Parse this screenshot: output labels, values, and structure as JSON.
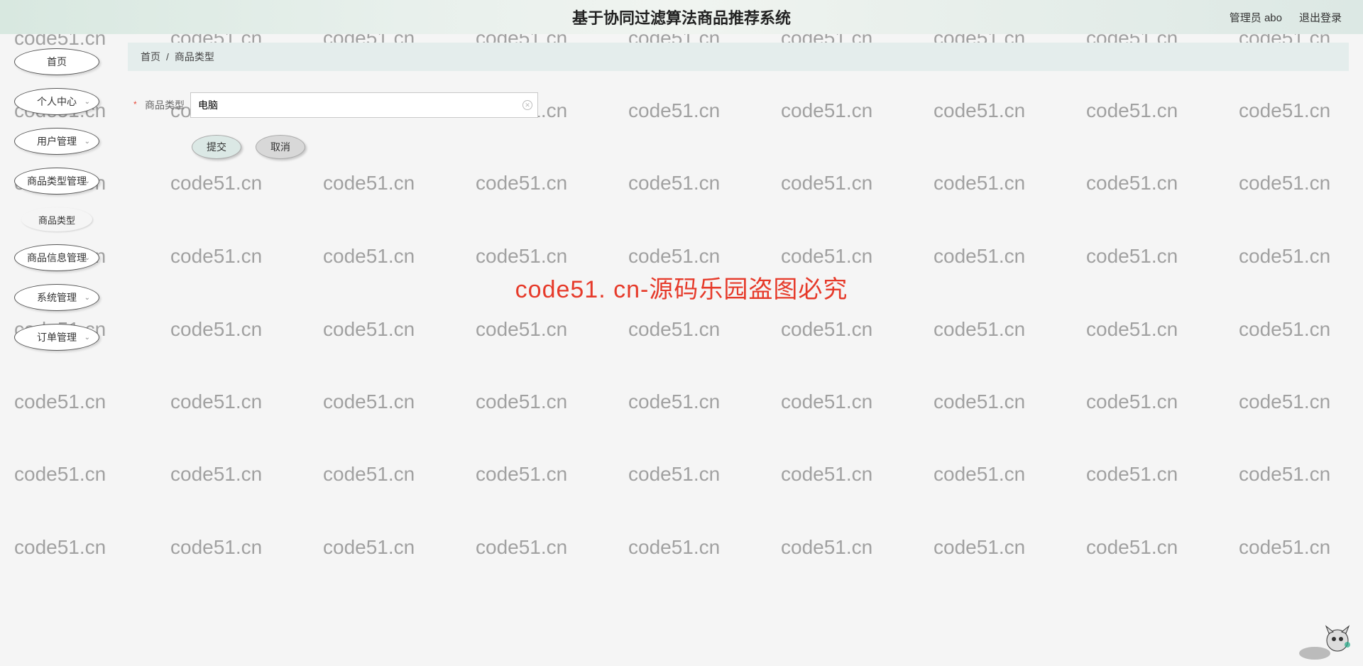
{
  "header": {
    "title": "基于协同过滤算法商品推荐系统",
    "user_label": "管理员 abo",
    "logout": "退出登录"
  },
  "sidebar": {
    "items": [
      {
        "label": "首页",
        "hasChevron": false
      },
      {
        "label": "个人中心",
        "hasChevron": true
      },
      {
        "label": "用户管理",
        "hasChevron": true
      },
      {
        "label": "商品类型管理",
        "hasChevron": true
      },
      {
        "label": "商品类型",
        "hasChevron": false,
        "sub": true
      },
      {
        "label": "商品信息管理",
        "hasChevron": true
      },
      {
        "label": "系统管理",
        "hasChevron": true
      },
      {
        "label": "订单管理",
        "hasChevron": true
      }
    ]
  },
  "breadcrumb": {
    "home": "首页",
    "sep": "/",
    "current": "商品类型"
  },
  "form": {
    "label": "商品类型",
    "value": "电脑",
    "submit": "提交",
    "cancel": "取消"
  },
  "watermark": {
    "text": "code51.cn",
    "center": "code51. cn-源码乐园盗图必究"
  }
}
